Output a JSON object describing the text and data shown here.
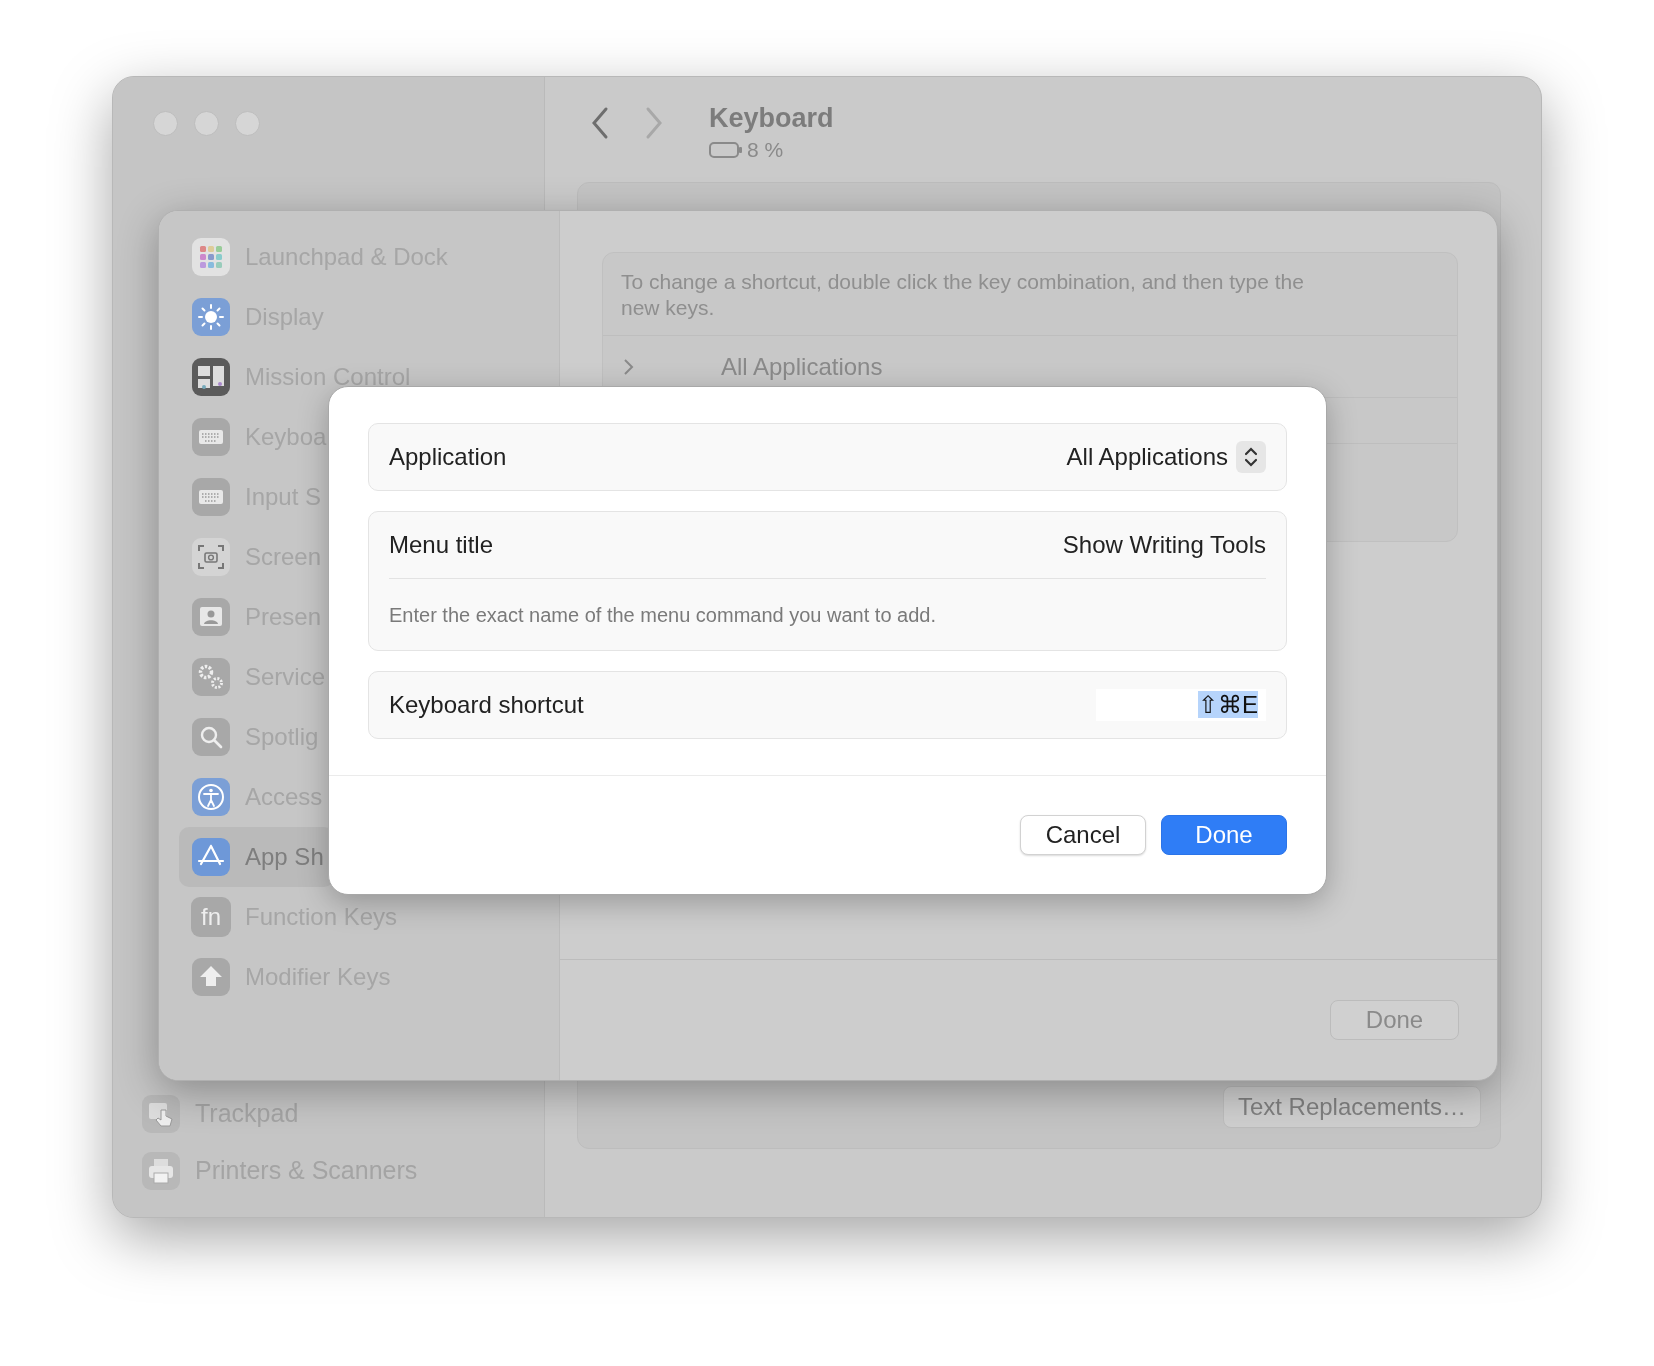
{
  "window": {
    "title": "Keyboard",
    "battery": "8 %",
    "sidebar": {
      "items": [
        {
          "label": "Trackpad"
        },
        {
          "label": "Printers & Scanners"
        }
      ]
    },
    "text_replacements_button": "Text Replacements…"
  },
  "sheet": {
    "sidebar": {
      "items": [
        {
          "label": "Launchpad & Dock",
          "selected": false
        },
        {
          "label": "Display",
          "selected": false
        },
        {
          "label": "Mission Control",
          "selected": false
        },
        {
          "label": "Keyboa",
          "selected": false
        },
        {
          "label": "Input S",
          "selected": false
        },
        {
          "label": "Screen",
          "selected": false
        },
        {
          "label": "Presen",
          "selected": false
        },
        {
          "label": "Service",
          "selected": false
        },
        {
          "label": "Spotlig",
          "selected": false
        },
        {
          "label": "Access",
          "selected": false
        },
        {
          "label": "App Sh",
          "selected": true
        },
        {
          "label": "Function Keys",
          "selected": false,
          "icon_text": "fn"
        },
        {
          "label": "Modifier Keys",
          "selected": false
        }
      ]
    },
    "info_text": "To change a shortcut, double click the key combination, and then type the new keys.",
    "rows": [
      {
        "label": "All Applications",
        "expanded": false
      }
    ],
    "done_button": "Done"
  },
  "dialog": {
    "fields": [
      {
        "kind": "popup",
        "label": "Application",
        "value": "All Applications"
      },
      {
        "kind": "text",
        "label": "Menu title",
        "value": "Show Writing Tools",
        "hint": "Enter the exact name of the menu command you want to add."
      },
      {
        "kind": "shortcut",
        "label": "Keyboard shortcut",
        "value": "⇧⌘E",
        "value_selected": true
      }
    ],
    "buttons": [
      {
        "label": "Cancel",
        "kind": "secondary"
      },
      {
        "label": "Done",
        "kind": "primary"
      }
    ]
  }
}
